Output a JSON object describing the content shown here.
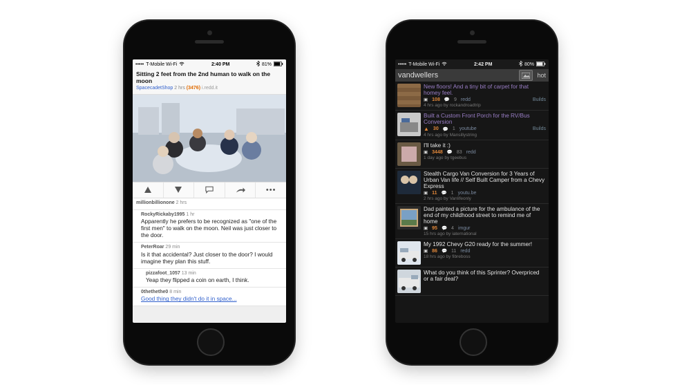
{
  "left_phone": {
    "status_bar": {
      "signal": "•••••",
      "carrier": "T-Mobile Wi-Fi",
      "wifi_icon": "wifi",
      "time": "2:40 PM",
      "bluetooth": "bt",
      "battery_pct": "81%",
      "battery_icon": "battery"
    },
    "post": {
      "title": "Sitting 2 feet from the 2nd human to walk on the moon",
      "subreddit": "SpacecadetShop",
      "age": "2 hrs",
      "score": "(3476)",
      "domain": "i.redd.it"
    },
    "actions": {
      "upvote": "↑",
      "downvote": "↓",
      "comment": "💬",
      "share": "↗",
      "more": "•••"
    },
    "comments": [
      {
        "user": "millionbillionone",
        "age": "2 hrs",
        "body": ""
      },
      {
        "user": "RockyRickaby1995",
        "age": "1 hr",
        "body": "Apparently he prefers to be recognized as \"one of the first men\" to walk on the moon. Neil was just closer to the door."
      },
      {
        "user": "PeterRoar",
        "age": "29 min",
        "body": "Is it that accidental? Just closer to the door? I would imagine they plan this stuff."
      },
      {
        "user": "pizzafoot_1057",
        "age": "13 min",
        "body": "Yeap they flipped a coin on earth, I think."
      },
      {
        "user": "0thethethe0",
        "age": "8 min",
        "body": "Good thing they didn't do it in space..."
      }
    ]
  },
  "right_phone": {
    "status_bar": {
      "signal": "•••••",
      "carrier": "T-Mobile Wi-Fi",
      "wifi_icon": "wifi",
      "time": "2:42 PM",
      "bluetooth": "bt",
      "battery_pct": "80%",
      "battery_icon": "battery"
    },
    "header": {
      "subreddit": "vandwellers",
      "gallery_icon": "🖼",
      "sort": "hot"
    },
    "posts": [
      {
        "title": "New floors! And a tiny bit of carpet for that homey feel.",
        "title_color": "purple",
        "score": "108",
        "comments": "9",
        "domain": "redd",
        "flair": "Builds",
        "meta": "4 hrs ago by rockandroadtrip",
        "thumb": "wood"
      },
      {
        "title": "Built a Custom Front Porch for the RV/Bus Conversion",
        "title_color": "purple",
        "score": "30",
        "comments": "1",
        "domain": "youtube",
        "flair": "Builds",
        "meta": "4 hrs ago by Mansillystring",
        "thumb": "rv",
        "arrow": true
      },
      {
        "title": "I'll take it :)",
        "title_color": "white",
        "score": "3448",
        "comments": "83",
        "domain": "redd",
        "flair": "",
        "meta": "1 day ago by tgeebus",
        "thumb": "van1"
      },
      {
        "title": "Stealth Cargo Van Conversion for 3 Years of Urban Van life // Self Built Camper from a Chevy Express",
        "title_color": "white",
        "score": "11",
        "comments": "1",
        "domain": "youtu.be",
        "flair": "",
        "meta": "2 hrs ago by Vanlifeonly",
        "thumb": "van2"
      },
      {
        "title": "Dad painted a picture for the ambulance of the end of my childhood street to remind me of home",
        "title_color": "white",
        "score": "95",
        "comments": "4",
        "domain": "imgur",
        "flair": "",
        "meta": "15 hrs ago by iaternational",
        "thumb": "paint"
      },
      {
        "title": "My 1992 Chevy G20 ready for the summer!",
        "title_color": "white",
        "score": "86",
        "comments": "11",
        "domain": "redd",
        "flair": "",
        "meta": "18 hrs ago by fibreboss",
        "thumb": "g20"
      },
      {
        "title": "What do you think of this Sprinter? Overpriced or a fair deal?",
        "title_color": "white",
        "score": "",
        "comments": "",
        "domain": "",
        "flair": "",
        "meta": "",
        "thumb": "sprinter"
      }
    ]
  }
}
